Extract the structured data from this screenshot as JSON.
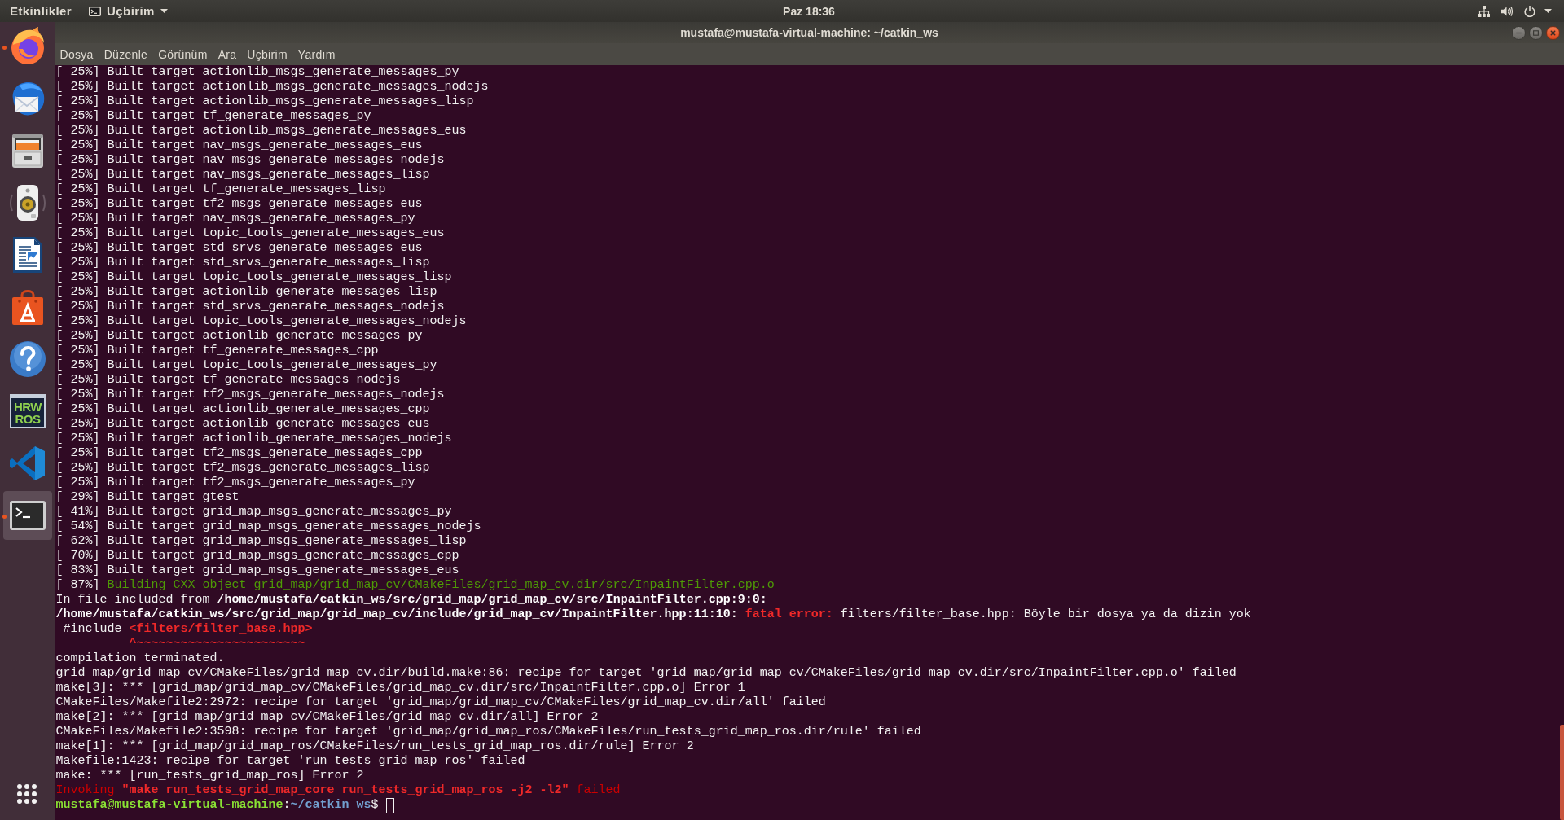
{
  "top_bar": {
    "activities": "Etkinlikler",
    "app_menu": "Uçbirim",
    "clock": "Paz 18:36"
  },
  "dock": {
    "items": [
      {
        "kind": "browser",
        "running": true,
        "selected": false
      },
      {
        "kind": "mail",
        "running": false,
        "selected": false
      },
      {
        "kind": "files",
        "running": false,
        "selected": false
      },
      {
        "kind": "speaker",
        "running": false,
        "selected": false
      },
      {
        "kind": "document",
        "running": false,
        "selected": false
      },
      {
        "kind": "store",
        "running": false,
        "selected": false
      },
      {
        "kind": "help",
        "running": false,
        "selected": false
      },
      {
        "kind": "badge",
        "text": [
          "HRW",
          "ROS"
        ],
        "running": false,
        "selected": false
      },
      {
        "kind": "code-editor",
        "running": false,
        "selected": false
      },
      {
        "kind": "terminal",
        "running": true,
        "selected": true
      }
    ]
  },
  "window": {
    "title": "mustafa@mustafa-virtual-machine: ~/catkin_ws",
    "menu": [
      "Dosya",
      "Düzenle",
      "Görünüm",
      "Ara",
      "Uçbirim",
      "Yardım"
    ]
  },
  "terminal": {
    "lines": [
      {
        "text": "[ 25%] Built target actionlib_msgs_generate_messages_py"
      },
      {
        "text": "[ 25%] Built target actionlib_msgs_generate_messages_nodejs"
      },
      {
        "text": "[ 25%] Built target actionlib_msgs_generate_messages_lisp"
      },
      {
        "text": "[ 25%] Built target tf_generate_messages_py"
      },
      {
        "text": "[ 25%] Built target actionlib_msgs_generate_messages_eus"
      },
      {
        "text": "[ 25%] Built target nav_msgs_generate_messages_eus"
      },
      {
        "text": "[ 25%] Built target nav_msgs_generate_messages_nodejs"
      },
      {
        "text": "[ 25%] Built target nav_msgs_generate_messages_lisp"
      },
      {
        "text": "[ 25%] Built target tf_generate_messages_lisp"
      },
      {
        "text": "[ 25%] Built target tf2_msgs_generate_messages_eus"
      },
      {
        "text": "[ 25%] Built target nav_msgs_generate_messages_py"
      },
      {
        "text": "[ 25%] Built target topic_tools_generate_messages_eus"
      },
      {
        "text": "[ 25%] Built target std_srvs_generate_messages_eus"
      },
      {
        "text": "[ 25%] Built target std_srvs_generate_messages_lisp"
      },
      {
        "text": "[ 25%] Built target topic_tools_generate_messages_lisp"
      },
      {
        "text": "[ 25%] Built target actionlib_generate_messages_lisp"
      },
      {
        "text": "[ 25%] Built target std_srvs_generate_messages_nodejs"
      },
      {
        "text": "[ 25%] Built target topic_tools_generate_messages_nodejs"
      },
      {
        "text": "[ 25%] Built target actionlib_generate_messages_py"
      },
      {
        "text": "[ 25%] Built target tf_generate_messages_cpp"
      },
      {
        "text": "[ 25%] Built target topic_tools_generate_messages_py"
      },
      {
        "text": "[ 25%] Built target tf_generate_messages_nodejs"
      },
      {
        "text": "[ 25%] Built target tf2_msgs_generate_messages_nodejs"
      },
      {
        "text": "[ 25%] Built target actionlib_generate_messages_cpp"
      },
      {
        "text": "[ 25%] Built target actionlib_generate_messages_eus"
      },
      {
        "text": "[ 25%] Built target actionlib_generate_messages_nodejs"
      },
      {
        "text": "[ 25%] Built target tf2_msgs_generate_messages_cpp"
      },
      {
        "text": "[ 25%] Built target tf2_msgs_generate_messages_lisp"
      },
      {
        "text": "[ 25%] Built target tf2_msgs_generate_messages_py"
      },
      {
        "text": "[ 29%] Built target gtest"
      },
      {
        "text": "[ 41%] Built target grid_map_msgs_generate_messages_py"
      },
      {
        "text": "[ 54%] Built target grid_map_msgs_generate_messages_nodejs"
      },
      {
        "text": "[ 62%] Built target grid_map_msgs_generate_messages_lisp"
      },
      {
        "text": "[ 70%] Built target grid_map_msgs_generate_messages_cpp"
      },
      {
        "text": "[ 83%] Built target grid_map_msgs_generate_messages_eus"
      },
      {
        "segments": [
          {
            "kind": "plain",
            "text": "[ 87%] "
          },
          {
            "kind": "building",
            "text": "Building CXX object grid_map/grid_map_cv/CMakeFiles/grid_map_cv.dir/src/InpaintFilter.cpp.o"
          }
        ]
      },
      {
        "segments": [
          {
            "kind": "plain",
            "text": "In file included from "
          },
          {
            "kind": "bold",
            "text": "/home/mustafa/catkin_ws/src/grid_map/grid_map_cv/src/InpaintFilter.cpp:9:0:"
          }
        ]
      },
      {
        "segments": [
          {
            "kind": "bold",
            "text": "/home/mustafa/catkin_ws/src/grid_map/grid_map_cv/include/grid_map_cv/InpaintFilter.hpp:11:10: "
          },
          {
            "kind": "error",
            "text": "fatal error:"
          },
          {
            "kind": "plain",
            "text": " filters/filter_base.hpp: Böyle bir dosya ya da dizin yok"
          }
        ]
      },
      {
        "segments": [
          {
            "kind": "plain",
            "text": " #include "
          },
          {
            "kind": "error",
            "text": "<filters/filter_base.hpp>"
          }
        ]
      },
      {
        "segments": [
          {
            "kind": "error",
            "text": "          ^~~~~~~~~~~~~~~~~~~~~~~~"
          }
        ]
      },
      {
        "text": "compilation terminated."
      },
      {
        "text": "grid_map/grid_map_cv/CMakeFiles/grid_map_cv.dir/build.make:86: recipe for target 'grid_map/grid_map_cv/CMakeFiles/grid_map_cv.dir/src/InpaintFilter.cpp.o' failed"
      },
      {
        "text": "make[3]: *** [grid_map/grid_map_cv/CMakeFiles/grid_map_cv.dir/src/InpaintFilter.cpp.o] Error 1"
      },
      {
        "text": "CMakeFiles/Makefile2:2972: recipe for target 'grid_map/grid_map_cv/CMakeFiles/grid_map_cv.dir/all' failed"
      },
      {
        "text": "make[2]: *** [grid_map/grid_map_cv/CMakeFiles/grid_map_cv.dir/all] Error 2"
      },
      {
        "text": "CMakeFiles/Makefile2:3598: recipe for target 'grid_map/grid_map_ros/CMakeFiles/run_tests_grid_map_ros.dir/rule' failed"
      },
      {
        "text": "make[1]: *** [grid_map/grid_map_ros/CMakeFiles/run_tests_grid_map_ros.dir/rule] Error 2"
      },
      {
        "text": "Makefile:1423: recipe for target 'run_tests_grid_map_ros' failed"
      },
      {
        "text": "make: *** [run_tests_grid_map_ros] Error 2"
      },
      {
        "segments": [
          {
            "kind": "error-dim",
            "text": "Invoking "
          },
          {
            "kind": "error",
            "text": "\"make run_tests_grid_map_core run_tests_grid_map_ros -j2 -l2\""
          },
          {
            "kind": "error-dim",
            "text": " failed"
          }
        ]
      }
    ],
    "prompt": {
      "user": "mustafa@mustafa-virtual-machine",
      "separator": ":",
      "path": "~/catkin_ws",
      "symbol": "$",
      "cursor_filled": false
    }
  }
}
